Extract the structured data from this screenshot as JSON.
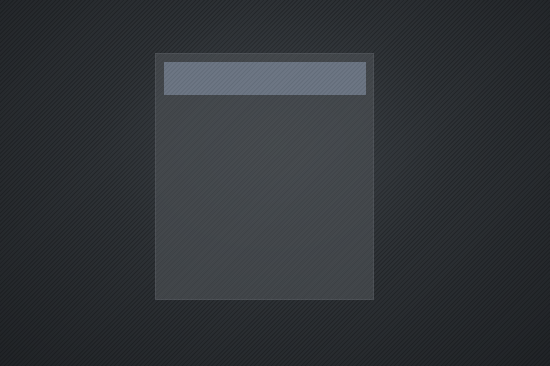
{
  "panel": {
    "header_text": ""
  },
  "colors": {
    "background": "#2a2e32",
    "panel": "#484c51",
    "header_bar": "#687280"
  }
}
